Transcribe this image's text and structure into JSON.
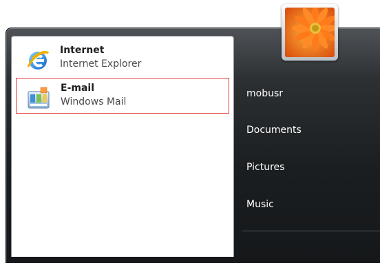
{
  "start_menu": {
    "pinned": [
      {
        "title": "Internet",
        "subtitle": "Internet Explorer",
        "icon": "internet-explorer-icon"
      },
      {
        "title": "E-mail",
        "subtitle": "Windows Mail",
        "icon": "windows-mail-icon"
      }
    ],
    "user_picture": "flower-user-picture",
    "right_items": [
      "mobusr",
      "Documents",
      "Pictures",
      "Music"
    ],
    "colors": {
      "selection_border": "#e23a3a",
      "menu_background": "#1b1e20",
      "right_text": "#ffffff"
    }
  }
}
